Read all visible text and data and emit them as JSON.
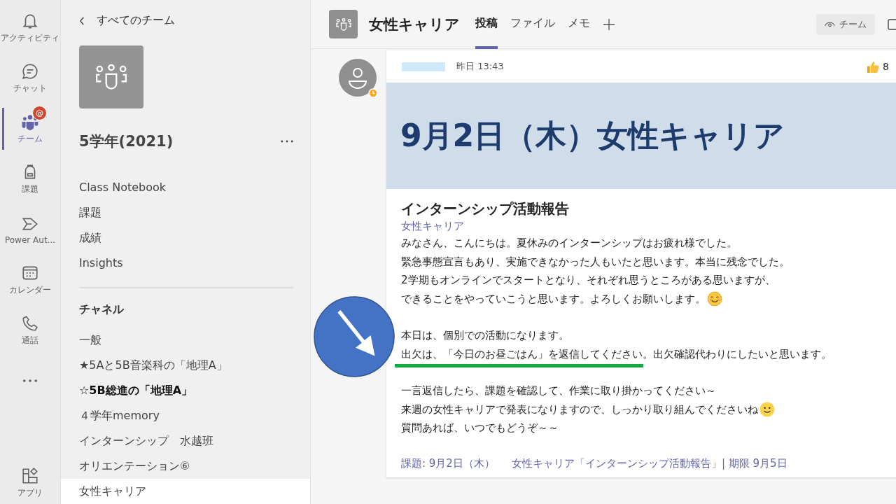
{
  "rail": {
    "items": [
      {
        "kind": "bell",
        "label": "アクティビティ",
        "selected": false
      },
      {
        "kind": "chat",
        "label": "チャット",
        "selected": false
      },
      {
        "kind": "teams",
        "label": "チーム",
        "selected": true,
        "badge": "@"
      },
      {
        "kind": "backpack",
        "label": "課題",
        "selected": false
      },
      {
        "kind": "flow",
        "label": "Power Aut...",
        "selected": false
      },
      {
        "kind": "calendar",
        "label": "カレンダー",
        "selected": false
      },
      {
        "kind": "phone",
        "label": "通話",
        "selected": false
      },
      {
        "kind": "more",
        "selected": false
      },
      {
        "kind": "apps",
        "label": "アプリ",
        "selected": false
      }
    ]
  },
  "team_panel": {
    "back_link": "すべてのチーム",
    "team_name": "5学年(2021)",
    "links": [
      "Class Notebook",
      "課題",
      "成績",
      "Insights"
    ],
    "channels_heading": "チャネル",
    "channels": [
      {
        "name": "一般",
        "unread": false,
        "selected": false
      },
      {
        "name": "★5Aと5B音楽科の「地理A」",
        "unread": false,
        "selected": false
      },
      {
        "name": "☆5B総進の「地理A」",
        "unread": true,
        "selected": false
      },
      {
        "name": "４学年memory",
        "unread": false,
        "selected": false
      },
      {
        "name": "インターンシップ　水越班",
        "unread": false,
        "selected": false
      },
      {
        "name": "オリエンテーション⑥",
        "unread": false,
        "selected": false
      },
      {
        "name": "女性キャリア",
        "unread": false,
        "selected": true
      }
    ]
  },
  "header": {
    "channel_name": "女性キャリア",
    "tabs": [
      {
        "label": "投稿",
        "selected": true
      },
      {
        "label": "ファイル",
        "selected": false
      },
      {
        "label": "メモ",
        "selected": false
      }
    ],
    "team_button": "チーム"
  },
  "post": {
    "time": "昨日 13:43",
    "likes": "8",
    "banner_title": "9月2日（木）女性キャリア",
    "subject": "インターンシップ活動報告",
    "channel_tag": "女性キャリア",
    "paragraphs": [
      [
        {
          "kind": "plain",
          "text": "みなさん、こんにちは。夏休みのインターンシップはお疲れ様でした。"
        },
        {
          "kind": "plain",
          "text": "緊急事態宣言もあり、実施できなかった人もいたと思います。本当に残念でした。"
        },
        {
          "kind": "plain",
          "text": "2学期もオンラインでスタートとなり、それぞれ思うところがある思いますが、"
        },
        {
          "kind": "blush",
          "text": "できることをやっていこうと思います。よろしくお願いします。"
        }
      ],
      [
        {
          "kind": "plain",
          "text": "本日は、個別での活動になります。"
        },
        {
          "kind": "marked",
          "text": "出欠は、「今日のお昼ごはん」を返信してください。出欠確認代わりにしたいと思います。"
        }
      ],
      [
        {
          "kind": "plain",
          "text": "一言返信したら、課題を確認して、作業に取り掛かってください～"
        },
        {
          "kind": "smile",
          "text": "来週の女性キャリアで発表になりますので、しっかり取り組んでくださいね"
        },
        {
          "kind": "plain",
          "text": "質問あれば、いつでもどうぞ～～"
        }
      ]
    ],
    "assignment_label": "課題: 9月2日（木）",
    "assignment_link": "女性キャリア「インターンシップ活動報告」| 期限 9月5日"
  }
}
